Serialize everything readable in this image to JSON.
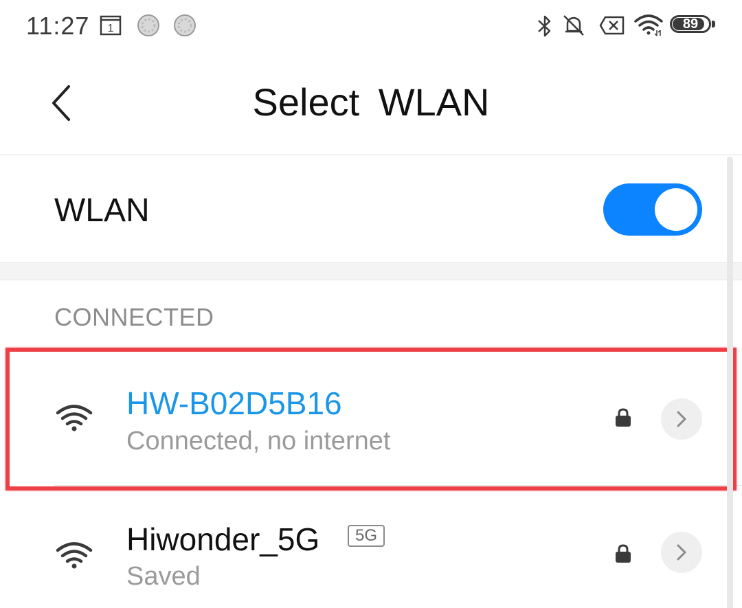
{
  "status_bar": {
    "time": "11:27",
    "calendar_day": "1",
    "battery_level": "89",
    "icons": [
      "calendar-icon",
      "notification-dot-icon",
      "notification-dot-icon",
      "bluetooth-icon",
      "mute-icon",
      "no-sim-icon",
      "wifi-icon",
      "battery-icon"
    ]
  },
  "header": {
    "back_icon": "chevron-left-icon",
    "title": "Select WLAN"
  },
  "wlan_toggle": {
    "label": "WLAN",
    "state": "on",
    "accent_color": "#0d84ff"
  },
  "sections": {
    "connected_header": "CONNECTED"
  },
  "networks": [
    {
      "name": "HW-B02D5B16",
      "status": "Connected, no internet",
      "secured": true,
      "name_color": "#1a96e8",
      "highlighted": true,
      "highlight_color": "#ef4047"
    },
    {
      "name": "Hiwonder_5G",
      "badge": "5G",
      "status": "Saved",
      "secured": true
    }
  ]
}
